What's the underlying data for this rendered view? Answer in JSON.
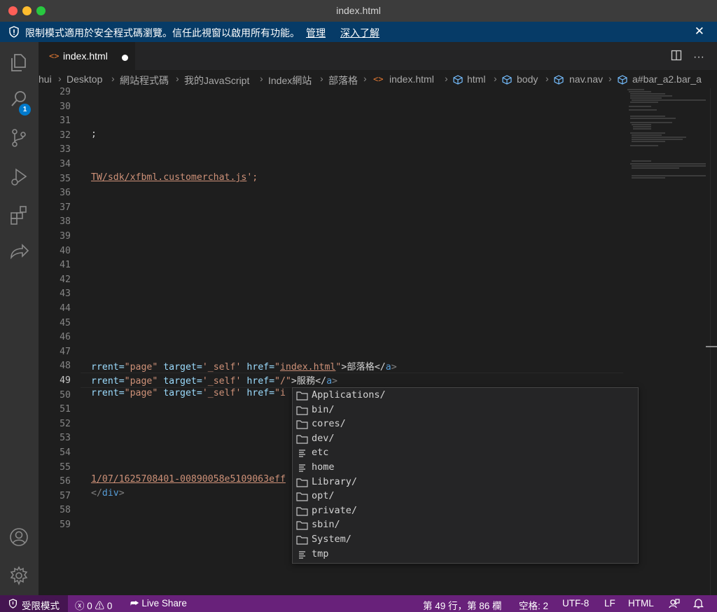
{
  "window": {
    "title": "index.html"
  },
  "banner": {
    "message": "限制模式適用於安全程式碼瀏覽。信任此視窗以啟用所有功能。",
    "manage_label": "管理",
    "learn_more_label": "深入了解"
  },
  "activity_bar": {
    "explorer_badge": "1",
    "icons": [
      "files-icon",
      "search-icon",
      "source-control-icon",
      "run-debug-icon",
      "extensions-icon",
      "live-share-icon",
      "account-icon",
      "settings-gear-icon"
    ]
  },
  "tabs": [
    {
      "label": "index.html",
      "icon": "<>",
      "dirty": true
    }
  ],
  "breadcrumb": [
    "hui",
    "Desktop",
    "網站程式碼",
    "我的JavaScript",
    "Index網站",
    "部落格",
    "index.html",
    "html",
    "body",
    "nav.nav",
    "a#bar_a2.bar_a"
  ],
  "editor": {
    "line_numbers": [
      "29",
      "30",
      "31",
      "32",
      "33",
      "34",
      "35",
      "36",
      "37",
      "38",
      "39",
      "40",
      "41",
      "42",
      "43",
      "44",
      "45",
      "46",
      "47",
      "48",
      "49",
      "50",
      "51",
      "52",
      "53",
      "54",
      "55",
      "56",
      "57",
      "58",
      "59"
    ],
    "active_line": "49",
    "lines": {
      "l32": ";",
      "l35a": "TW/sdk/xfbml.customerchat.js",
      "l35b": "';",
      "l48": [
        "rrent=",
        "\"page\"",
        " target=",
        "'_self'",
        " href=",
        "\"",
        "index.html",
        "\"",
        ">部落格</",
        "a",
        ">"
      ],
      "l49": [
        "rrent=",
        "\"page\"",
        " target=",
        "'_self'",
        " href=",
        "\"/\"",
        ">服務</",
        "a",
        ">"
      ],
      "l50": [
        "rrent=",
        "\"page\"",
        " target=",
        "'_self'",
        " href=",
        "\"i"
      ],
      "l56": "1/07/1625708401-00890058e5109063eff",
      "l57": [
        "</",
        "div",
        ">"
      ]
    }
  },
  "suggestions": [
    {
      "label": "Applications/",
      "kind": "folder"
    },
    {
      "label": "bin/",
      "kind": "folder"
    },
    {
      "label": "cores/",
      "kind": "folder"
    },
    {
      "label": "dev/",
      "kind": "folder"
    },
    {
      "label": "etc",
      "kind": "file"
    },
    {
      "label": "home",
      "kind": "file"
    },
    {
      "label": "Library/",
      "kind": "folder"
    },
    {
      "label": "opt/",
      "kind": "folder"
    },
    {
      "label": "private/",
      "kind": "folder"
    },
    {
      "label": "sbin/",
      "kind": "folder"
    },
    {
      "label": "System/",
      "kind": "folder"
    },
    {
      "label": "tmp",
      "kind": "file"
    }
  ],
  "statusbar": {
    "restricted_mode": "受限模式",
    "errors": "0",
    "warnings": "0",
    "live_share": "Live Share",
    "position": "第 49 行，第 86 欄",
    "spaces": "空格: 2",
    "encoding": "UTF-8",
    "eol": "LF",
    "language": "HTML"
  },
  "colors": {
    "statusbar": "#68217a",
    "banner": "#063b67",
    "string": "#ce9178",
    "attr": "#9cdcfe",
    "tag": "#569cd6"
  }
}
